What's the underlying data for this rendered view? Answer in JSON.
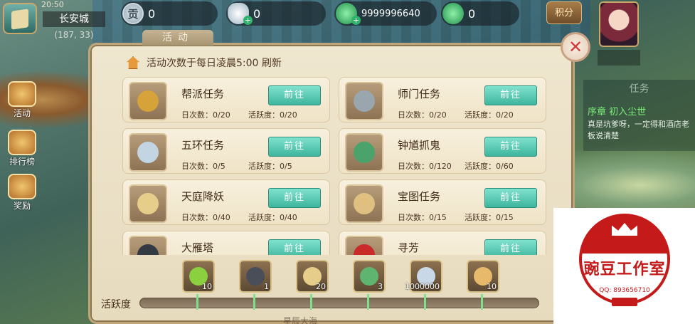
{
  "hud": {
    "time": "20:50",
    "city": "长安城",
    "coord": "(187, 33)",
    "resources": [
      {
        "id": "gong",
        "glyph": "贡",
        "value": "0"
      },
      {
        "id": "silver",
        "value": "0"
      },
      {
        "id": "jade",
        "value": "9999996640"
      },
      {
        "id": "locked_jade",
        "value": "0"
      }
    ],
    "jifen": "积分"
  },
  "quest_tracker": {
    "title": "任务",
    "name": "序章 初入尘世",
    "desc": "真是坑爹呀，一定得和酒店老板说清楚"
  },
  "left_menu": [
    {
      "label": "活动"
    },
    {
      "label": "排行榜"
    },
    {
      "label": "奖励"
    }
  ],
  "panel": {
    "tab": "活动",
    "notice": "活动次数于每日凌晨5:00 刷新",
    "go_label": "前往",
    "activities": [
      {
        "name": "帮派任务",
        "times": "日次数：0/20",
        "active": "活跃度：0/20",
        "icon_color": "#d6a23a"
      },
      {
        "name": "师门任务",
        "times": "日次数：0/20",
        "active": "活跃度：0/20",
        "icon_color": "#9aa6ad"
      },
      {
        "name": "五环任务",
        "times": "日次数：0/5",
        "active": "活跃度：0/5",
        "icon_color": "#c3d4e3"
      },
      {
        "name": "钟馗抓鬼",
        "times": "日次数：0/120",
        "active": "活跃度：0/60",
        "icon_color": "#4aa36a"
      },
      {
        "name": "天庭降妖",
        "times": "日次数：0/40",
        "active": "活跃度：0/40",
        "icon_color": "#e7cd8a"
      },
      {
        "name": "宝图任务",
        "times": "日次数：0/15",
        "active": "活跃度：0/15",
        "icon_color": "#e0c081"
      },
      {
        "name": "大雁塔",
        "times": "",
        "active": "",
        "icon_color": "#333a44"
      },
      {
        "name": "寻芳",
        "times": "",
        "active": "",
        "icon_color": "#c92a2a"
      }
    ]
  },
  "activity_bar": {
    "label": "活跃度",
    "progress_fraction": 0,
    "rewards": [
      {
        "count": "10",
        "color": "#8bd13f"
      },
      {
        "count": "1",
        "color": "#4a4e58"
      },
      {
        "count": "20",
        "color": "#e6cd8a"
      },
      {
        "count": "3",
        "color": "#5fb56f"
      },
      {
        "count": "1000000",
        "color": "#c9d8e6"
      },
      {
        "count": "10",
        "color": "#e7b96a"
      }
    ],
    "bottom_text": "星辰大海"
  },
  "watermark": {
    "title": "豌豆工作室",
    "qq": "QQ: 893656710"
  }
}
